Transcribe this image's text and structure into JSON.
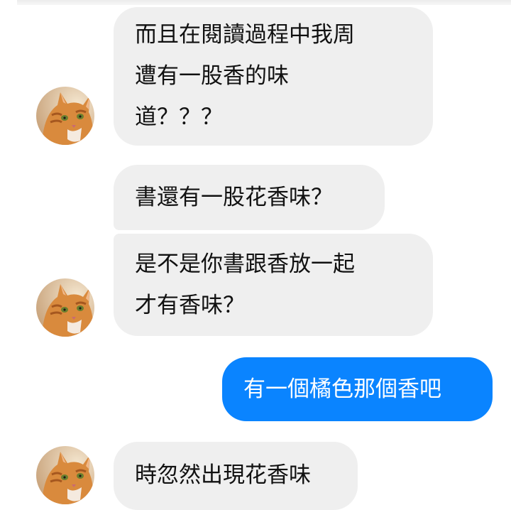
{
  "app": {
    "accent_color": "#0A84FF",
    "incoming_bubble_color": "#EFEFEF"
  },
  "messages": [
    {
      "direction": "incoming",
      "text": "而且在閱讀過程中我周\n遭有一股香的味\n道？？？",
      "avatar": "orange-tabby-cat-avatar"
    },
    {
      "direction": "incoming",
      "text": "書還有一股花香味？"
    },
    {
      "direction": "incoming",
      "text": "是不是你書跟香放一起\n才有香味？",
      "avatar": "orange-tabby-cat-avatar"
    },
    {
      "direction": "outgoing",
      "text": "有一個橘色那個香吧"
    },
    {
      "direction": "incoming",
      "text": "時忽然出現花香味",
      "avatar": "orange-tabby-cat-avatar"
    }
  ]
}
